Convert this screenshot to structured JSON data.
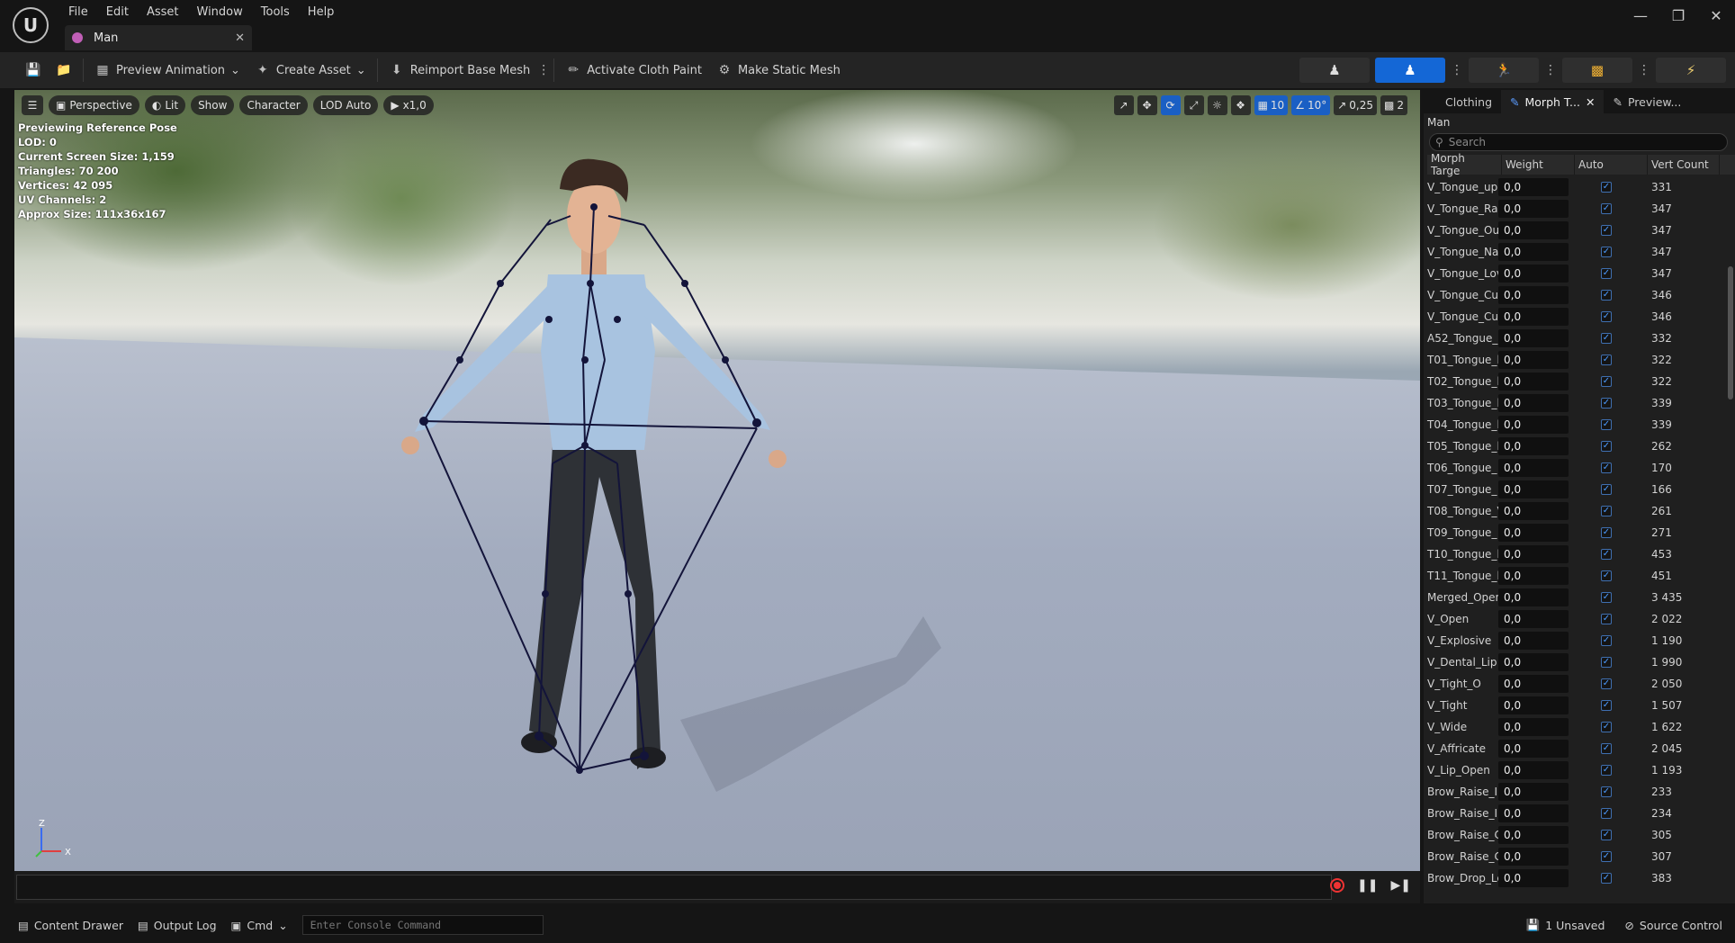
{
  "menu": [
    "File",
    "Edit",
    "Asset",
    "Window",
    "Tools",
    "Help"
  ],
  "tab": {
    "label": "Man"
  },
  "toolbar": {
    "preview_animation": "Preview Animation",
    "create_asset": "Create Asset",
    "reimport": "Reimport Base Mesh",
    "cloth_paint": "Activate Cloth Paint",
    "static_mesh": "Make Static Mesh"
  },
  "viewport": {
    "perspective": "Perspective",
    "lit": "Lit",
    "show": "Show",
    "character": "Character",
    "lod": "LOD Auto",
    "speed": "x1,0",
    "grid": "10",
    "angle": "10°",
    "scale": "0,25",
    "camera_speed": "2",
    "stats": [
      "Previewing Reference Pose",
      "LOD: 0",
      "Current Screen Size: 1,159",
      "Triangles: 70 200",
      "Vertices: 42 095",
      "UV Channels: 2",
      "Approx Size: 111x36x167"
    ],
    "axis_z": "Z",
    "axis_x": "X"
  },
  "panel": {
    "tabs": [
      "Clothing",
      "Morph T...",
      "Preview..."
    ],
    "title": "Man",
    "search_placeholder": "Search",
    "columns": [
      "Morph Targe",
      "Weight",
      "Auto",
      "Vert Count"
    ],
    "rows": [
      {
        "name": "V_Tongue_up",
        "weight": "0,0",
        "vert": "331"
      },
      {
        "name": "V_Tongue_Rai",
        "weight": "0,0",
        "vert": "347"
      },
      {
        "name": "V_Tongue_Ou",
        "weight": "0,0",
        "vert": "347"
      },
      {
        "name": "V_Tongue_Na",
        "weight": "0,0",
        "vert": "347"
      },
      {
        "name": "V_Tongue_Lov",
        "weight": "0,0",
        "vert": "347"
      },
      {
        "name": "V_Tongue_Cu",
        "weight": "0,0",
        "vert": "346"
      },
      {
        "name": "V_Tongue_Cu",
        "weight": "0,0",
        "vert": "346"
      },
      {
        "name": "A52_Tongue_(",
        "weight": "0,0",
        "vert": "332"
      },
      {
        "name": "T01_Tongue_l",
        "weight": "0,0",
        "vert": "322"
      },
      {
        "name": "T02_Tongue_l",
        "weight": "0,0",
        "vert": "322"
      },
      {
        "name": "T03_Tongue_l",
        "weight": "0,0",
        "vert": "339"
      },
      {
        "name": "T04_Tongue_l",
        "weight": "0,0",
        "vert": "339"
      },
      {
        "name": "T05_Tongue_l",
        "weight": "0,0",
        "vert": "262"
      },
      {
        "name": "T06_Tongue_",
        "weight": "0,0",
        "vert": "170"
      },
      {
        "name": "T07_Tongue_",
        "weight": "0,0",
        "vert": "166"
      },
      {
        "name": "T08_Tongue_V",
        "weight": "0,0",
        "vert": "261"
      },
      {
        "name": "T09_Tongue_",
        "weight": "0,0",
        "vert": "271"
      },
      {
        "name": "T10_Tongue_l",
        "weight": "0,0",
        "vert": "453"
      },
      {
        "name": "T11_Tongue_l",
        "weight": "0,0",
        "vert": "451"
      },
      {
        "name": "Merged_Open",
        "weight": "0,0",
        "vert": "3 435"
      },
      {
        "name": "V_Open",
        "weight": "0,0",
        "vert": "2 022"
      },
      {
        "name": "V_Explosive",
        "weight": "0,0",
        "vert": "1 190"
      },
      {
        "name": "V_Dental_Lip",
        "weight": "0,0",
        "vert": "1 990"
      },
      {
        "name": "V_Tight_O",
        "weight": "0,0",
        "vert": "2 050"
      },
      {
        "name": "V_Tight",
        "weight": "0,0",
        "vert": "1 507"
      },
      {
        "name": "V_Wide",
        "weight": "0,0",
        "vert": "1 622"
      },
      {
        "name": "V_Affricate",
        "weight": "0,0",
        "vert": "2 045"
      },
      {
        "name": "V_Lip_Open",
        "weight": "0,0",
        "vert": "1 193"
      },
      {
        "name": "Brow_Raise_I",
        "weight": "0,0",
        "vert": "233"
      },
      {
        "name": "Brow_Raise_I",
        "weight": "0,0",
        "vert": "234"
      },
      {
        "name": "Brow_Raise_C",
        "weight": "0,0",
        "vert": "305"
      },
      {
        "name": "Brow_Raise_C",
        "weight": "0,0",
        "vert": "307"
      },
      {
        "name": "Brow_Drop_Le",
        "weight": "0,0",
        "vert": "383"
      }
    ]
  },
  "status": {
    "content_drawer": "Content Drawer",
    "output_log": "Output Log",
    "cmd": "Cmd",
    "console_placeholder": "Enter Console Command",
    "unsaved": "1 Unsaved",
    "source_control": "Source Control"
  }
}
